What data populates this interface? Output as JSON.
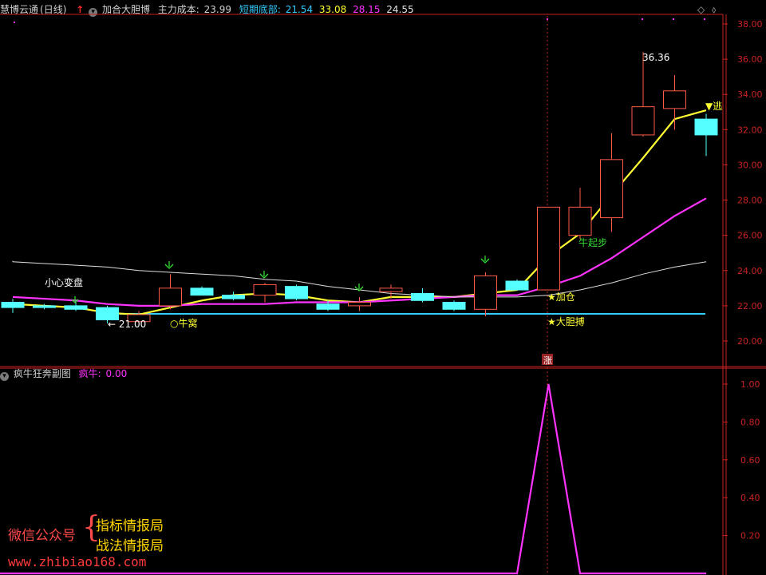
{
  "header": {
    "app_title": "慧博云通",
    "period": "(日线)",
    "indicator_name": "加合大胆博",
    "cost_label": "主力成本:",
    "cost_value": "23.99",
    "bottom_label": "短期底部:",
    "bottom_value": "21.54",
    "value_yellow": "33.08",
    "value_magenta": "28.15",
    "value_white": "24.55"
  },
  "sub_header": {
    "title": "疯牛狂奔副图",
    "label": "疯牛:",
    "value": "0.00"
  },
  "price_axis": {
    "ticks": [
      "38.00",
      "36.00",
      "34.00",
      "32.00",
      "30.00",
      "28.00",
      "26.00",
      "24.00",
      "22.00",
      "20.00"
    ]
  },
  "sub_axis": {
    "ticks": [
      "1.00",
      "0.80",
      "0.60",
      "0.40",
      "0.20"
    ]
  },
  "annotations": {
    "caution": "小心变盘",
    "low": "← 21.00",
    "bull_nest": "○牛窝",
    "high": "36.36",
    "escape": "▼逃",
    "bull_start": "牛起步",
    "add_position": "★加仓",
    "bold_bet": "★大胆搏",
    "marker": "涨"
  },
  "watermark": {
    "wechat": "微信公众号",
    "line1": "指标情报局",
    "line2": "战法情报局",
    "url": "www.zhibiao168.com"
  },
  "colors": {
    "up": "#ff5a4a",
    "down": "#55ffff",
    "yellow": "#ffff33",
    "magenta": "#ff33ff",
    "cyan": "#33ccff",
    "axis": "#cc2222"
  },
  "chart_data": {
    "type": "candlestick",
    "ylim": [
      19.0,
      38.8
    ],
    "candles": [
      {
        "o": 22.2,
        "h": 22.4,
        "l": 21.6,
        "c": 21.9
      },
      {
        "o": 22.0,
        "h": 22.1,
        "l": 21.8,
        "c": 21.9
      },
      {
        "o": 22.0,
        "h": 22.3,
        "l": 21.7,
        "c": 21.8
      },
      {
        "o": 21.9,
        "h": 22.0,
        "l": 21.0,
        "c": 21.2
      },
      {
        "o": 21.1,
        "h": 21.7,
        "l": 21.0,
        "c": 21.5
      },
      {
        "o": 22.0,
        "h": 23.8,
        "l": 21.8,
        "c": 23.0
      },
      {
        "o": 23.0,
        "h": 23.1,
        "l": 22.6,
        "c": 22.6
      },
      {
        "o": 22.6,
        "h": 22.8,
        "l": 22.3,
        "c": 22.4
      },
      {
        "o": 22.6,
        "h": 23.3,
        "l": 22.2,
        "c": 23.2
      },
      {
        "o": 23.1,
        "h": 23.2,
        "l": 22.3,
        "c": 22.4
      },
      {
        "o": 22.1,
        "h": 22.3,
        "l": 21.7,
        "c": 21.8
      },
      {
        "o": 22.0,
        "h": 22.5,
        "l": 21.7,
        "c": 22.2
      },
      {
        "o": 22.8,
        "h": 23.2,
        "l": 22.4,
        "c": 23.0
      },
      {
        "o": 22.7,
        "h": 23.0,
        "l": 22.2,
        "c": 22.3
      },
      {
        "o": 22.2,
        "h": 22.3,
        "l": 21.7,
        "c": 21.8
      },
      {
        "o": 21.8,
        "h": 23.9,
        "l": 21.4,
        "c": 23.7
      },
      {
        "o": 23.4,
        "h": 23.5,
        "l": 22.9,
        "c": 22.9
      },
      {
        "o": 22.9,
        "h": 27.6,
        "l": 22.9,
        "c": 27.6
      },
      {
        "o": 26.0,
        "h": 28.7,
        "l": 25.8,
        "c": 27.6
      },
      {
        "o": 27.0,
        "h": 31.8,
        "l": 26.2,
        "c": 30.3
      },
      {
        "o": 31.7,
        "h": 36.4,
        "l": 31.6,
        "c": 33.3
      },
      {
        "o": 33.2,
        "h": 35.1,
        "l": 32.0,
        "c": 34.2
      },
      {
        "o": 32.6,
        "h": 32.9,
        "l": 30.5,
        "c": 31.7
      }
    ],
    "series": [
      {
        "name": "",
        "color": "yellow",
        "values": [
          22.1,
          22.0,
          21.9,
          21.6,
          21.5,
          21.9,
          22.3,
          22.6,
          22.7,
          22.6,
          22.3,
          22.2,
          22.5,
          22.5,
          22.5,
          22.7,
          22.9,
          24.8,
          26.1,
          28.3,
          30.4,
          32.6,
          33.1
        ]
      },
      {
        "name": "",
        "color": "magenta",
        "values": [
          22.5,
          22.4,
          22.3,
          22.1,
          22.0,
          22.0,
          22.1,
          22.1,
          22.1,
          22.2,
          22.2,
          22.2,
          22.3,
          22.4,
          22.5,
          22.6,
          22.6,
          23.1,
          23.7,
          24.7,
          25.9,
          27.1,
          28.1
        ]
      },
      {
        "name": "",
        "color": "white",
        "values": [
          24.5,
          24.4,
          24.3,
          24.2,
          24.0,
          23.9,
          23.8,
          23.7,
          23.5,
          23.4,
          23.1,
          22.9,
          22.7,
          22.6,
          22.5,
          22.5,
          22.5,
          22.6,
          22.9,
          23.3,
          23.8,
          24.2,
          24.5
        ]
      }
    ],
    "support_level": 21.54,
    "bull_signal": [
      0,
      0,
      0,
      0,
      0,
      0,
      0,
      0,
      0,
      0,
      0,
      0,
      0,
      0,
      0,
      0,
      0,
      1,
      0,
      0,
      0,
      0,
      0
    ]
  }
}
